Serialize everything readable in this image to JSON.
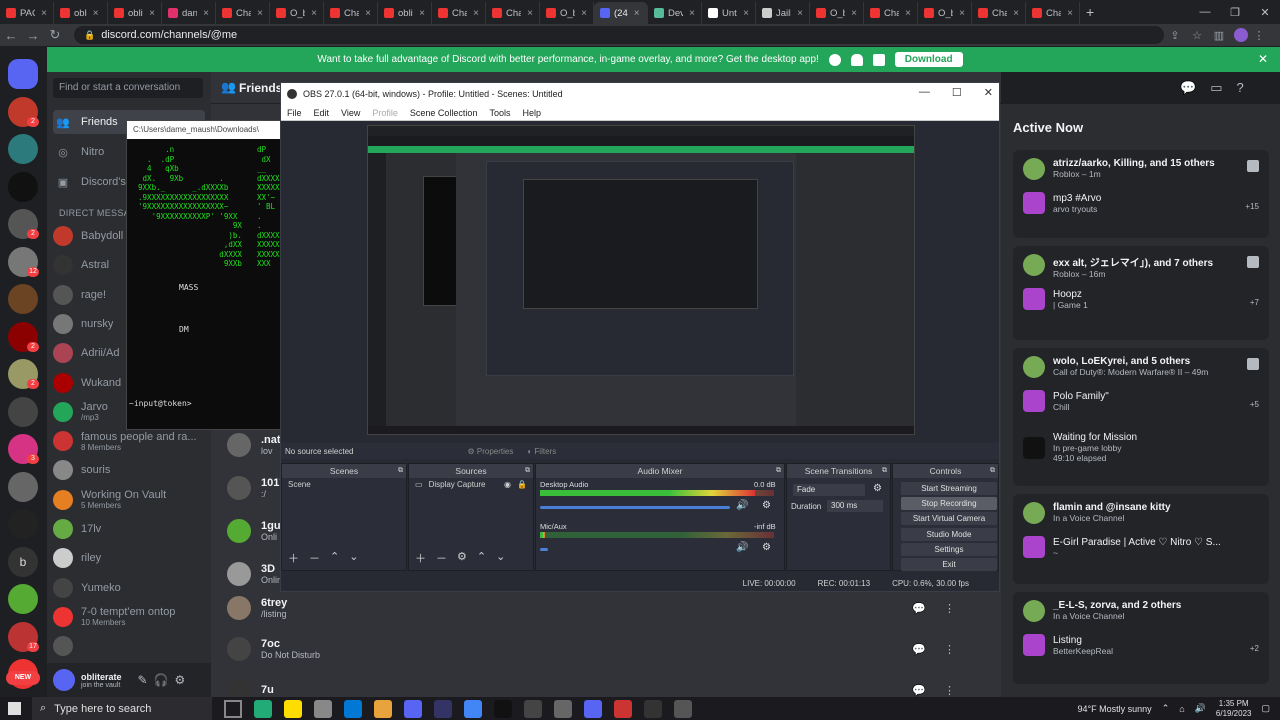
{
  "browser": {
    "tabs": [
      {
        "label": "PAC",
        "color": "#e33"
      },
      {
        "label": "obl",
        "color": "#e33"
      },
      {
        "label": "oblitera",
        "color": "#e33"
      },
      {
        "label": "daniel",
        "color": "#e1306c"
      },
      {
        "label": "Channe",
        "color": "#e33"
      },
      {
        "label": "O_blite",
        "color": "#e33"
      },
      {
        "label": "Channe",
        "color": "#e33"
      },
      {
        "label": "oblitera",
        "color": "#e33"
      },
      {
        "label": "Channe",
        "color": "#e33"
      },
      {
        "label": "Channe",
        "color": "#e33"
      },
      {
        "label": "O_blite",
        "color": "#e33"
      },
      {
        "label": "(24",
        "color": "#5865f2"
      },
      {
        "label": "Develo",
        "color": "#5b9"
      },
      {
        "label": "Untitle",
        "color": "#fff"
      },
      {
        "label": "Jailbrea",
        "color": "#ccc"
      },
      {
        "label": "O_blite",
        "color": "#e33"
      },
      {
        "label": "Channe",
        "color": "#e33"
      },
      {
        "label": "O_blite",
        "color": "#e33"
      },
      {
        "label": "Channe",
        "color": "#e33"
      },
      {
        "label": "Channe",
        "color": "#e33"
      }
    ],
    "active_tab_index": 11,
    "url": "discord.com/channels/@me",
    "window_controls": [
      "—",
      "❐",
      "✕"
    ]
  },
  "banner": {
    "text": "Want to take full advantage of Discord with better performance, in-game overlay, and more? Get the desktop app!",
    "download_label": "Download",
    "color": "#23a55a"
  },
  "guilds": [
    {
      "color": "#5865f2",
      "badge": ""
    },
    {
      "color": "#c0392b",
      "badge": "2"
    },
    {
      "color": "#2c7a7b",
      "badge": ""
    },
    {
      "color": "#111",
      "badge": ""
    },
    {
      "color": "#555",
      "badge": "2"
    },
    {
      "color": "#777",
      "badge": "12"
    },
    {
      "color": "#6b4423",
      "badge": ""
    },
    {
      "color": "#8b0000",
      "badge": "2"
    },
    {
      "color": "#996",
      "badge": "2"
    },
    {
      "color": "#444",
      "badge": ""
    },
    {
      "color": "#d63384",
      "badge": "3"
    },
    {
      "color": "#666",
      "badge": ""
    },
    {
      "color": "#222",
      "badge": ""
    },
    {
      "color": "#333",
      "badge": ""
    },
    {
      "color": "#5a3",
      "badge": ""
    },
    {
      "color": "#b33",
      "badge": "17"
    },
    {
      "color": "#e33",
      "badge": ""
    }
  ],
  "guild_letter": "b",
  "new_badge": "NEW",
  "dm": {
    "search_placeholder": "Find or start a conversation",
    "nav": [
      {
        "label": "Friends",
        "icon": "friends-icon"
      },
      {
        "label": "Nitro",
        "icon": "nitro-icon"
      },
      {
        "label": "Discord's",
        "icon": "shop-icon"
      }
    ],
    "section_label": "DIRECT MESSAGES",
    "items": [
      {
        "name": "Babydoll",
        "sub": "",
        "color": "#c0392b"
      },
      {
        "name": "Astral",
        "sub": "",
        "color": "#333"
      },
      {
        "name": "rage!",
        "sub": "",
        "color": "#555"
      },
      {
        "name": "nursky",
        "sub": "",
        "color": "#777"
      },
      {
        "name": "Adrii/Ad",
        "sub": "",
        "color": "#a45"
      },
      {
        "name": "Wukand",
        "sub": "",
        "color": "#a00"
      },
      {
        "name": "Jarvo",
        "sub": "/mp3",
        "color": "#23a55a"
      },
      {
        "name": "famous people and ra...",
        "sub": "8 Members",
        "color": "#c33"
      },
      {
        "name": "souris",
        "sub": "",
        "color": "#888"
      },
      {
        "name": "Working On Vault",
        "sub": "5 Members",
        "color": "#e67e22"
      },
      {
        "name": "17lv",
        "sub": "",
        "color": "#6a4"
      },
      {
        "name": "riley",
        "sub": "",
        "color": "#ccc"
      },
      {
        "name": "Yumeko",
        "sub": "",
        "color": "#444"
      },
      {
        "name": "7-0 tempt'em ontop",
        "sub": "10 Members",
        "color": "#e33"
      },
      {
        "name": "",
        "sub": "",
        "color": "#555"
      }
    ],
    "user": {
      "name": "obliterate",
      "status": "join the vault"
    }
  },
  "main": {
    "header_label": "Friends",
    "friends": [
      {
        "name": ".nath",
        "status": "lov",
        "color": "#666"
      },
      {
        "name": "1017",
        "status": ":/",
        "color": "#555"
      },
      {
        "name": "1gun",
        "status": "Onli",
        "color": "#5a3"
      },
      {
        "name": "3D",
        "status": "Onlin",
        "color": "#999"
      },
      {
        "name": "6trey",
        "status": "/listing",
        "color": "#876"
      },
      {
        "name": "7oc",
        "status": "Do Not Disturb",
        "color": "#444"
      },
      {
        "name": "7u",
        "status": "",
        "color": "#333"
      }
    ]
  },
  "active_now": {
    "title": "Active Now",
    "cards": [
      {
        "title": "atrizz/aarko, Killing, and 15 others",
        "sub": "Roblox – 1m",
        "item": "mp3 #Arvo",
        "item_sub": "arvo tryouts",
        "count": "+15"
      },
      {
        "title": "exx alt, ジェレマイ」), and 7 others",
        "sub": "Roblox – 16m",
        "item": "Hoopz",
        "item_sub": "| Game 1",
        "count": "+7"
      },
      {
        "title": "wolo, LoEKyrei, and 5 others",
        "sub": "Call of Duty®: Modern Warfare® II – 49m",
        "item": "Polo Family\"",
        "item_sub": "Chill",
        "count": "+5",
        "item2": "Waiting for Mission",
        "item2_sub": "In pre-game lobby",
        "item2_sub2": "49:10 elapsed"
      },
      {
        "title": "flamin and @insane kitty",
        "sub": "In a Voice Channel",
        "item": "E-Girl Paradise | Active ♡ Nitro ♡ S...",
        "item_sub": "~",
        "count": ""
      },
      {
        "title": "_E-L-S, zorva, and 2 others",
        "sub": "In a Voice Channel",
        "item": "Listing",
        "item_sub": "BetterKeepReal",
        "count": "+2"
      }
    ]
  },
  "terminal": {
    "title": "C:\\Users\\dame_maush\\Downloads\\",
    "ascii": "        .n\n    .  .dP\n    4   qXb\n   dX.   9Xb        .\n  9XXb._      _.dXXXXb\n  .9XXXXXXXXXXXXXXXXXX\n  '9XXXXXXXXXXXXXXXXX~\n     '9XXXXXXXXXXP' '9XX\n                       9X\n                      )b.\n                     ,dXX\n                    dXXXX\n                     9XXb",
    "right_ascii": "dP\n dX\n__\ndXXXXbo\nXXXXXX\nXX'~\n' BL\n.\n.\ndXXXX\nXXXXX\nXXXXX\nXXX",
    "mass": "MASS",
    "dm": "DM",
    "prompt": "~input@token>"
  },
  "obs": {
    "title": "OBS 27.0.1 (64-bit, windows) - Profile: Untitled - Scenes: Untitled",
    "menu": [
      "File",
      "Edit",
      "View",
      "Profile",
      "Scene Collection",
      "Tools",
      "Help"
    ],
    "no_source": "No source selected",
    "properties": "Properties",
    "filters": "Filters",
    "docks": {
      "scenes": {
        "title": "Scenes",
        "items": [
          "Scene"
        ]
      },
      "sources": {
        "title": "Sources",
        "items": [
          "Display Capture"
        ]
      },
      "mixer": {
        "title": "Audio Mixer",
        "channels": [
          {
            "name": "Desktop Audio",
            "db": "0.0 dB",
            "level": 0.92
          },
          {
            "name": "Mic/Aux",
            "db": "-inf dB",
            "level": 0.02
          }
        ]
      },
      "transitions": {
        "title": "Scene Transitions",
        "type": "Fade",
        "duration_label": "Duration",
        "duration": "300 ms"
      },
      "controls": {
        "title": "Controls",
        "buttons": [
          "Start Streaming",
          "Stop Recording",
          "Start Virtual Camera",
          "Studio Mode",
          "Settings",
          "Exit"
        ]
      }
    },
    "status": {
      "live": "LIVE: 00:00:00",
      "rec": "REC: 00:01:13",
      "cpu": "CPU: 0.6%, 30.00 fps"
    }
  },
  "taskbar": {
    "search_placeholder": "Type here to search",
    "apps": [
      "#2a7",
      "#fd0",
      "#888",
      "#0078d4",
      "#e8a33d",
      "#5865f2",
      "#336",
      "#4285f4",
      "#111",
      "#444",
      "#666",
      "#5865f2",
      "#c33",
      "#333",
      "#555"
    ],
    "weather": "94°F  Mostly sunny",
    "time": "1:35 PM",
    "date": "6/19/2023"
  }
}
